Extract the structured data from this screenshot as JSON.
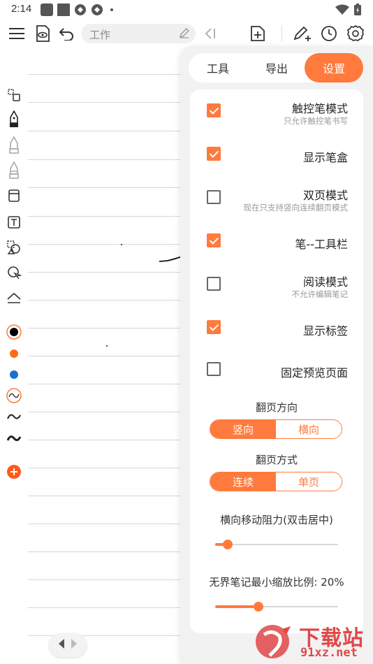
{
  "status_bar": {
    "time": "2:14"
  },
  "toolbar": {
    "title_placeholder": "工作"
  },
  "panel": {
    "tabs": [
      {
        "label": "工具",
        "active": false
      },
      {
        "label": "导出",
        "active": false
      },
      {
        "label": "设置",
        "active": true
      }
    ],
    "options": [
      {
        "title": "触控笔模式",
        "subtitle": "只允许触控笔书写",
        "checked": true
      },
      {
        "title": "显示笔盒",
        "subtitle": "",
        "checked": true
      },
      {
        "title": "双页模式",
        "subtitle": "现在只支持竖向连续翻页模式",
        "checked": false
      },
      {
        "title": "笔--工具栏",
        "subtitle": "",
        "checked": true
      },
      {
        "title": "阅读模式",
        "subtitle": "不允许编辑笔记",
        "checked": false
      },
      {
        "title": "显示标签",
        "subtitle": "",
        "checked": true
      },
      {
        "title": "固定预览页面",
        "subtitle": "",
        "checked": false
      }
    ],
    "flip_direction": {
      "label": "翻页方向",
      "options": [
        "竖向",
        "横向"
      ],
      "selected": "竖向"
    },
    "flip_mode": {
      "label": "翻页方式",
      "options": [
        "连续",
        "单页"
      ],
      "selected": "连续"
    },
    "horizontal_resistance": {
      "label": "横向移动阻力(双击居中)",
      "value_fraction": 0.1
    },
    "min_zoom": {
      "label": "无界笔记最小缩放比例: 20%",
      "value_fraction": 0.35
    }
  },
  "watermark": {
    "line1": "下载站",
    "line2": "91xz.net"
  },
  "colors": {
    "accent": "#ff7a3d",
    "pen_black": "#000000",
    "pen_orange": "#ff6a1a",
    "pen_blue": "#1a6fd0",
    "watermark_red": "#e04848"
  }
}
